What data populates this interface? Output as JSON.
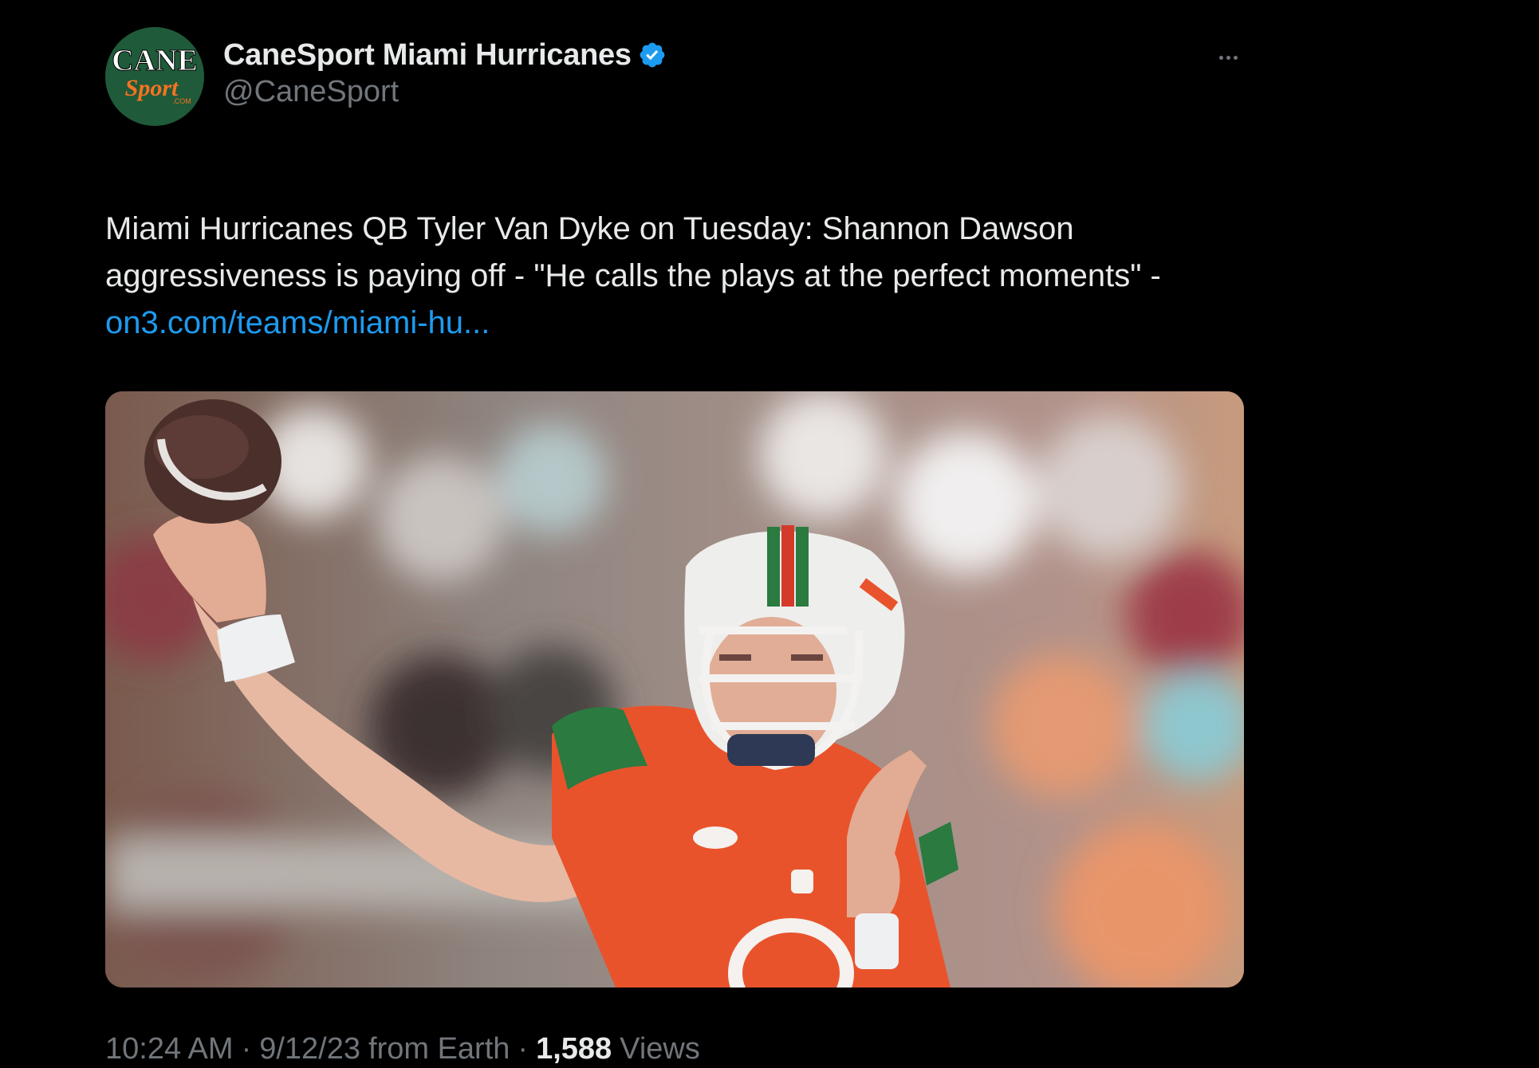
{
  "author": {
    "display_name": "CaneSport Miami Hurricanes",
    "handle": "@CaneSport",
    "verified": true,
    "avatar_text_top": "CANE",
    "avatar_text_bottom": "Sport",
    "avatar_text_small": ".COM"
  },
  "tweet": {
    "text": "Miami Hurricanes QB Tyler Van Dyke on Tuesday: Shannon Dawson aggressiveness is paying off - \"He calls the plays at the perfect moments\" - ",
    "link_text": "on3.com/teams/miami-hu...",
    "media_alt": "Miami quarterback in orange jersey and white helmet throwing a football"
  },
  "meta": {
    "time": "10:24 AM",
    "separator": "·",
    "date": "9/12/23",
    "source": "from Earth",
    "views_count": "1,588",
    "views_label": "Views"
  },
  "colors": {
    "background": "#000000",
    "text_primary": "#e7e9ea",
    "text_secondary": "#71767b",
    "link": "#1d9bf0",
    "verified": "#1d9bf0",
    "avatar_green": "#1f5a3a",
    "avatar_orange": "#f47321"
  },
  "icons": {
    "verified": "verified-badge-icon",
    "more": "more-horizontal-icon"
  }
}
